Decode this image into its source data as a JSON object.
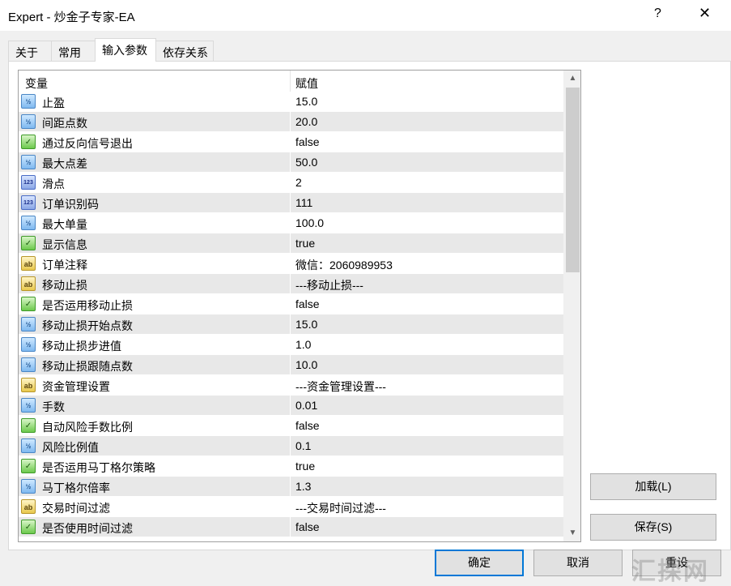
{
  "window": {
    "title": "Expert - 炒金子专家-EA",
    "help_label": "?",
    "close_label": "✕"
  },
  "tabs": [
    {
      "label": "关于"
    },
    {
      "label": "常用"
    },
    {
      "label": "输入参数"
    },
    {
      "label": "依存关系"
    }
  ],
  "grid": {
    "col_variable": "变量",
    "col_value": "赋值",
    "scroll_up": "▲",
    "scroll_down": "▼",
    "rows": [
      {
        "icon": "num",
        "glyph": "½",
        "name": "止盈",
        "value": "15.0"
      },
      {
        "icon": "num",
        "glyph": "½",
        "name": "间距点数",
        "value": "20.0"
      },
      {
        "icon": "bool",
        "glyph": "✓",
        "name": "通过反向信号退出",
        "value": "false"
      },
      {
        "icon": "num",
        "glyph": "½",
        "name": "最大点差",
        "value": "50.0"
      },
      {
        "icon": "int",
        "glyph": "123",
        "name": "滑点",
        "value": "2"
      },
      {
        "icon": "int",
        "glyph": "123",
        "name": "订单识别码",
        "value": "111"
      },
      {
        "icon": "num",
        "glyph": "½",
        "name": "最大单量",
        "value": "100.0"
      },
      {
        "icon": "bool",
        "glyph": "✓",
        "name": "显示信息",
        "value": "true"
      },
      {
        "icon": "str",
        "glyph": "ab",
        "name": "订单注释",
        "value": "微信：2060989953"
      },
      {
        "icon": "str",
        "glyph": "ab",
        "name": "移动止损",
        "value": "---移动止损---"
      },
      {
        "icon": "bool",
        "glyph": "✓",
        "name": "是否运用移动止损",
        "value": "false"
      },
      {
        "icon": "num",
        "glyph": "½",
        "name": "移动止损开始点数",
        "value": "15.0"
      },
      {
        "icon": "num",
        "glyph": "½",
        "name": "移动止损步进值",
        "value": "1.0"
      },
      {
        "icon": "num",
        "glyph": "½",
        "name": "移动止损跟随点数",
        "value": "10.0"
      },
      {
        "icon": "str",
        "glyph": "ab",
        "name": "资金管理设置",
        "value": "---资金管理设置---"
      },
      {
        "icon": "num",
        "glyph": "½",
        "name": "手数",
        "value": "0.01"
      },
      {
        "icon": "bool",
        "glyph": "✓",
        "name": "自动风险手数比例",
        "value": "false"
      },
      {
        "icon": "num",
        "glyph": "½",
        "name": "风险比例值",
        "value": "0.1"
      },
      {
        "icon": "bool",
        "glyph": "✓",
        "name": "是否运用马丁格尔策略",
        "value": "true"
      },
      {
        "icon": "num",
        "glyph": "½",
        "name": "马丁格尔倍率",
        "value": "1.3"
      },
      {
        "icon": "str",
        "glyph": "ab",
        "name": "交易时间过滤",
        "value": "---交易时间过滤---"
      },
      {
        "icon": "bool",
        "glyph": "✓",
        "name": "是否使用时间过滤",
        "value": "false"
      }
    ]
  },
  "buttons": {
    "load": "加载(L)",
    "save": "保存(S)",
    "ok": "确定",
    "cancel": "取消",
    "reset": "重设"
  },
  "watermark": "汇探网"
}
